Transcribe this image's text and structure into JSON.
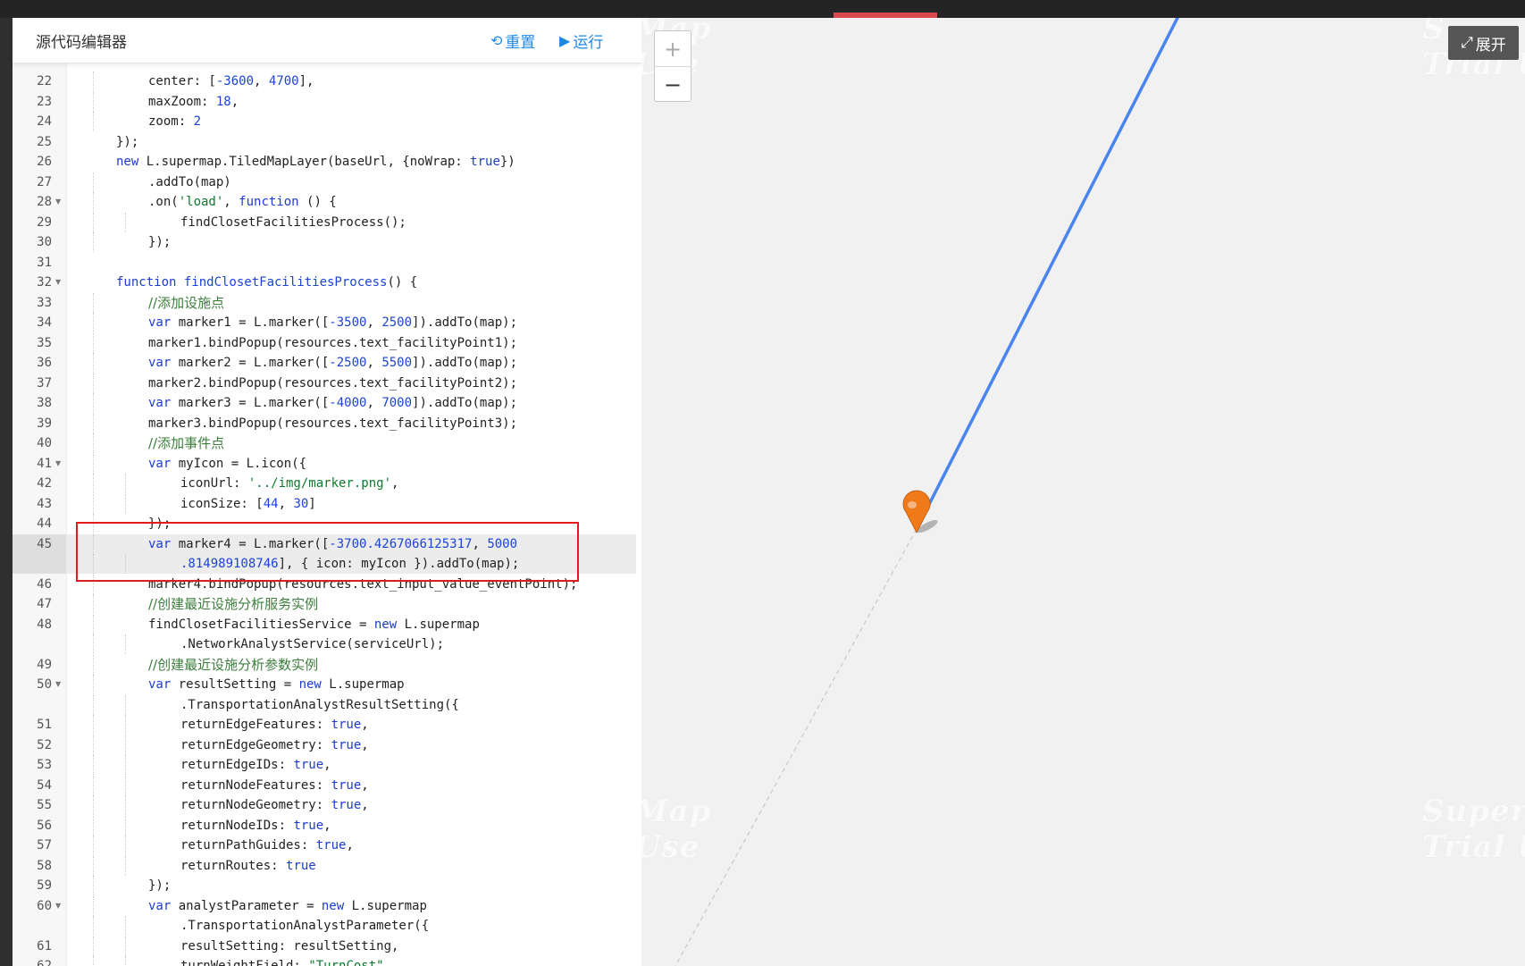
{
  "editor": {
    "title": "源代码编辑器",
    "reset_label": "重置",
    "run_label": "运行"
  },
  "code_lines": [
    {
      "n": "22",
      "fold": false,
      "indent": 2,
      "tokens": [
        [
          "p",
          "center: ["
        ],
        [
          "n",
          "-3600"
        ],
        [
          "p",
          ", "
        ],
        [
          "n",
          "4700"
        ],
        [
          "p",
          "],"
        ]
      ]
    },
    {
      "n": "23",
      "fold": false,
      "indent": 2,
      "tokens": [
        [
          "p",
          "maxZoom: "
        ],
        [
          "n",
          "18"
        ],
        [
          "p",
          ","
        ]
      ]
    },
    {
      "n": "24",
      "fold": false,
      "indent": 2,
      "tokens": [
        [
          "p",
          "zoom: "
        ],
        [
          "n",
          "2"
        ]
      ]
    },
    {
      "n": "25",
      "fold": false,
      "indent": 1,
      "tokens": [
        [
          "p",
          "});"
        ]
      ]
    },
    {
      "n": "26",
      "fold": false,
      "indent": 1,
      "tokens": [
        [
          "k",
          "new "
        ],
        [
          "p",
          "L.supermap.TiledMapLayer(baseUrl, {noWrap: "
        ],
        [
          "k",
          "true"
        ],
        [
          "p",
          "})"
        ]
      ]
    },
    {
      "n": "27",
      "fold": false,
      "indent": 2,
      "tokens": [
        [
          "p",
          ".addTo(map)"
        ]
      ]
    },
    {
      "n": "28",
      "fold": true,
      "indent": 2,
      "tokens": [
        [
          "p",
          ".on("
        ],
        [
          "s",
          "'load'"
        ],
        [
          "p",
          ", "
        ],
        [
          "k",
          "function"
        ],
        [
          "p",
          " () {"
        ]
      ]
    },
    {
      "n": "29",
      "fold": false,
      "indent": 3,
      "tokens": [
        [
          "p",
          "findClosetFacilitiesProcess();"
        ]
      ]
    },
    {
      "n": "30",
      "fold": false,
      "indent": 2,
      "tokens": [
        [
          "p",
          "});"
        ]
      ]
    },
    {
      "n": "31",
      "fold": false,
      "indent": 0,
      "tokens": []
    },
    {
      "n": "32",
      "fold": true,
      "indent": 1,
      "tokens": [
        [
          "k",
          "function "
        ],
        [
          "n",
          "findClosetFacilitiesProcess"
        ],
        [
          "p",
          "() {"
        ]
      ]
    },
    {
      "n": "33",
      "fold": false,
      "indent": 2,
      "tokens": [
        [
          "c",
          "//添加设施点"
        ]
      ]
    },
    {
      "n": "34",
      "fold": false,
      "indent": 2,
      "tokens": [
        [
          "k",
          "var "
        ],
        [
          "p",
          "marker1 = L.marker(["
        ],
        [
          "n",
          "-3500"
        ],
        [
          "p",
          ", "
        ],
        [
          "n",
          "2500"
        ],
        [
          "p",
          "]).addTo(map);"
        ]
      ]
    },
    {
      "n": "35",
      "fold": false,
      "indent": 2,
      "tokens": [
        [
          "p",
          "marker1.bindPopup(resources.text_facilityPoint1);"
        ]
      ]
    },
    {
      "n": "36",
      "fold": false,
      "indent": 2,
      "tokens": [
        [
          "k",
          "var "
        ],
        [
          "p",
          "marker2 = L.marker(["
        ],
        [
          "n",
          "-2500"
        ],
        [
          "p",
          ", "
        ],
        [
          "n",
          "5500"
        ],
        [
          "p",
          "]).addTo(map);"
        ]
      ]
    },
    {
      "n": "37",
      "fold": false,
      "indent": 2,
      "tokens": [
        [
          "p",
          "marker2.bindPopup(resources.text_facilityPoint2);"
        ]
      ]
    },
    {
      "n": "38",
      "fold": false,
      "indent": 2,
      "tokens": [
        [
          "k",
          "var "
        ],
        [
          "p",
          "marker3 = L.marker(["
        ],
        [
          "n",
          "-4000"
        ],
        [
          "p",
          ", "
        ],
        [
          "n",
          "7000"
        ],
        [
          "p",
          "]).addTo(map);"
        ]
      ]
    },
    {
      "n": "39",
      "fold": false,
      "indent": 2,
      "tokens": [
        [
          "p",
          "marker3.bindPopup(resources.text_facilityPoint3);"
        ]
      ]
    },
    {
      "n": "40",
      "fold": false,
      "indent": 2,
      "tokens": [
        [
          "c",
          "//添加事件点"
        ]
      ]
    },
    {
      "n": "41",
      "fold": true,
      "indent": 2,
      "tokens": [
        [
          "k",
          "var "
        ],
        [
          "p",
          "myIcon = L.icon({"
        ]
      ]
    },
    {
      "n": "42",
      "fold": false,
      "indent": 3,
      "tokens": [
        [
          "p",
          "iconUrl: "
        ],
        [
          "s",
          "'../img/marker.png'"
        ],
        [
          "p",
          ","
        ]
      ]
    },
    {
      "n": "43",
      "fold": false,
      "indent": 3,
      "tokens": [
        [
          "p",
          "iconSize: ["
        ],
        [
          "n",
          "44"
        ],
        [
          "p",
          ", "
        ],
        [
          "n",
          "30"
        ],
        [
          "p",
          "]"
        ]
      ]
    },
    {
      "n": "44",
      "fold": false,
      "indent": 2,
      "tokens": [
        [
          "p",
          "});"
        ]
      ]
    },
    {
      "n": "45",
      "fold": false,
      "indent": 2,
      "highlight": true,
      "tokens": [
        [
          "k",
          "var "
        ],
        [
          "p",
          "marker4 = L.marker(["
        ],
        [
          "n",
          "-3700.4267066125317"
        ],
        [
          "p",
          ", "
        ],
        [
          "n",
          "5000"
        ]
      ]
    },
    {
      "n": "",
      "fold": false,
      "indent": 3,
      "highlight2": true,
      "tokens": [
        [
          "n",
          ".814989108746"
        ],
        [
          "p",
          "], { icon: myIcon }).addTo(map);"
        ]
      ]
    },
    {
      "n": "46",
      "fold": false,
      "indent": 2,
      "tokens": [
        [
          "p",
          "marker4.bindPopup(resources.text_input_value_eventPoint);"
        ]
      ]
    },
    {
      "n": "47",
      "fold": false,
      "indent": 2,
      "tokens": [
        [
          "c",
          "//创建最近设施分析服务实例"
        ]
      ]
    },
    {
      "n": "48",
      "fold": false,
      "indent": 2,
      "tokens": [
        [
          "p",
          "findClosetFacilitiesService = "
        ],
        [
          "k",
          "new "
        ],
        [
          "p",
          "L.supermap"
        ]
      ]
    },
    {
      "n": "",
      "fold": false,
      "indent": 3,
      "tokens": [
        [
          "p",
          ".NetworkAnalystService(serviceUrl);"
        ]
      ]
    },
    {
      "n": "49",
      "fold": false,
      "indent": 2,
      "tokens": [
        [
          "c",
          "//创建最近设施分析参数实例"
        ]
      ]
    },
    {
      "n": "50",
      "fold": true,
      "indent": 2,
      "tokens": [
        [
          "k",
          "var "
        ],
        [
          "p",
          "resultSetting = "
        ],
        [
          "k",
          "new "
        ],
        [
          "p",
          "L.supermap"
        ]
      ]
    },
    {
      "n": "",
      "fold": false,
      "indent": 3,
      "tokens": [
        [
          "p",
          ".TransportationAnalystResultSetting({"
        ]
      ]
    },
    {
      "n": "51",
      "fold": false,
      "indent": 3,
      "tokens": [
        [
          "p",
          "returnEdgeFeatures: "
        ],
        [
          "k",
          "true"
        ],
        [
          "p",
          ","
        ]
      ]
    },
    {
      "n": "52",
      "fold": false,
      "indent": 3,
      "tokens": [
        [
          "p",
          "returnEdgeGeometry: "
        ],
        [
          "k",
          "true"
        ],
        [
          "p",
          ","
        ]
      ]
    },
    {
      "n": "53",
      "fold": false,
      "indent": 3,
      "tokens": [
        [
          "p",
          "returnEdgeIDs: "
        ],
        [
          "k",
          "true"
        ],
        [
          "p",
          ","
        ]
      ]
    },
    {
      "n": "54",
      "fold": false,
      "indent": 3,
      "tokens": [
        [
          "p",
          "returnNodeFeatures: "
        ],
        [
          "k",
          "true"
        ],
        [
          "p",
          ","
        ]
      ]
    },
    {
      "n": "55",
      "fold": false,
      "indent": 3,
      "tokens": [
        [
          "p",
          "returnNodeGeometry: "
        ],
        [
          "k",
          "true"
        ],
        [
          "p",
          ","
        ]
      ]
    },
    {
      "n": "56",
      "fold": false,
      "indent": 3,
      "tokens": [
        [
          "p",
          "returnNodeIDs: "
        ],
        [
          "k",
          "true"
        ],
        [
          "p",
          ","
        ]
      ]
    },
    {
      "n": "57",
      "fold": false,
      "indent": 3,
      "tokens": [
        [
          "p",
          "returnPathGuides: "
        ],
        [
          "k",
          "true"
        ],
        [
          "p",
          ","
        ]
      ]
    },
    {
      "n": "58",
      "fold": false,
      "indent": 3,
      "tokens": [
        [
          "p",
          "returnRoutes: "
        ],
        [
          "k",
          "true"
        ]
      ]
    },
    {
      "n": "59",
      "fold": false,
      "indent": 2,
      "tokens": [
        [
          "p",
          "});"
        ]
      ]
    },
    {
      "n": "60",
      "fold": true,
      "indent": 2,
      "tokens": [
        [
          "k",
          "var "
        ],
        [
          "p",
          "analystParameter = "
        ],
        [
          "k",
          "new "
        ],
        [
          "p",
          "L.supermap"
        ]
      ]
    },
    {
      "n": "",
      "fold": false,
      "indent": 3,
      "tokens": [
        [
          "p",
          ".TransportationAnalystParameter({"
        ]
      ]
    },
    {
      "n": "61",
      "fold": false,
      "indent": 3,
      "tokens": [
        [
          "p",
          "resultSetting: resultSetting,"
        ]
      ]
    },
    {
      "n": "62",
      "fold": false,
      "indent": 3,
      "tokens": [
        [
          "p",
          "turnWeightField: "
        ],
        [
          "s",
          "\"TurnCost\""
        ],
        [
          "p",
          ","
        ]
      ]
    }
  ],
  "map": {
    "zoom_in_label": "+",
    "zoom_out_label": "−",
    "expand_label": "展开",
    "watermarks": [
      "Map\nUse",
      "S\nTrial U",
      "Map\nUse",
      "SuperM\nTrial U"
    ],
    "route_color": "#4a84ee",
    "marker_color": "#f07a1a"
  }
}
